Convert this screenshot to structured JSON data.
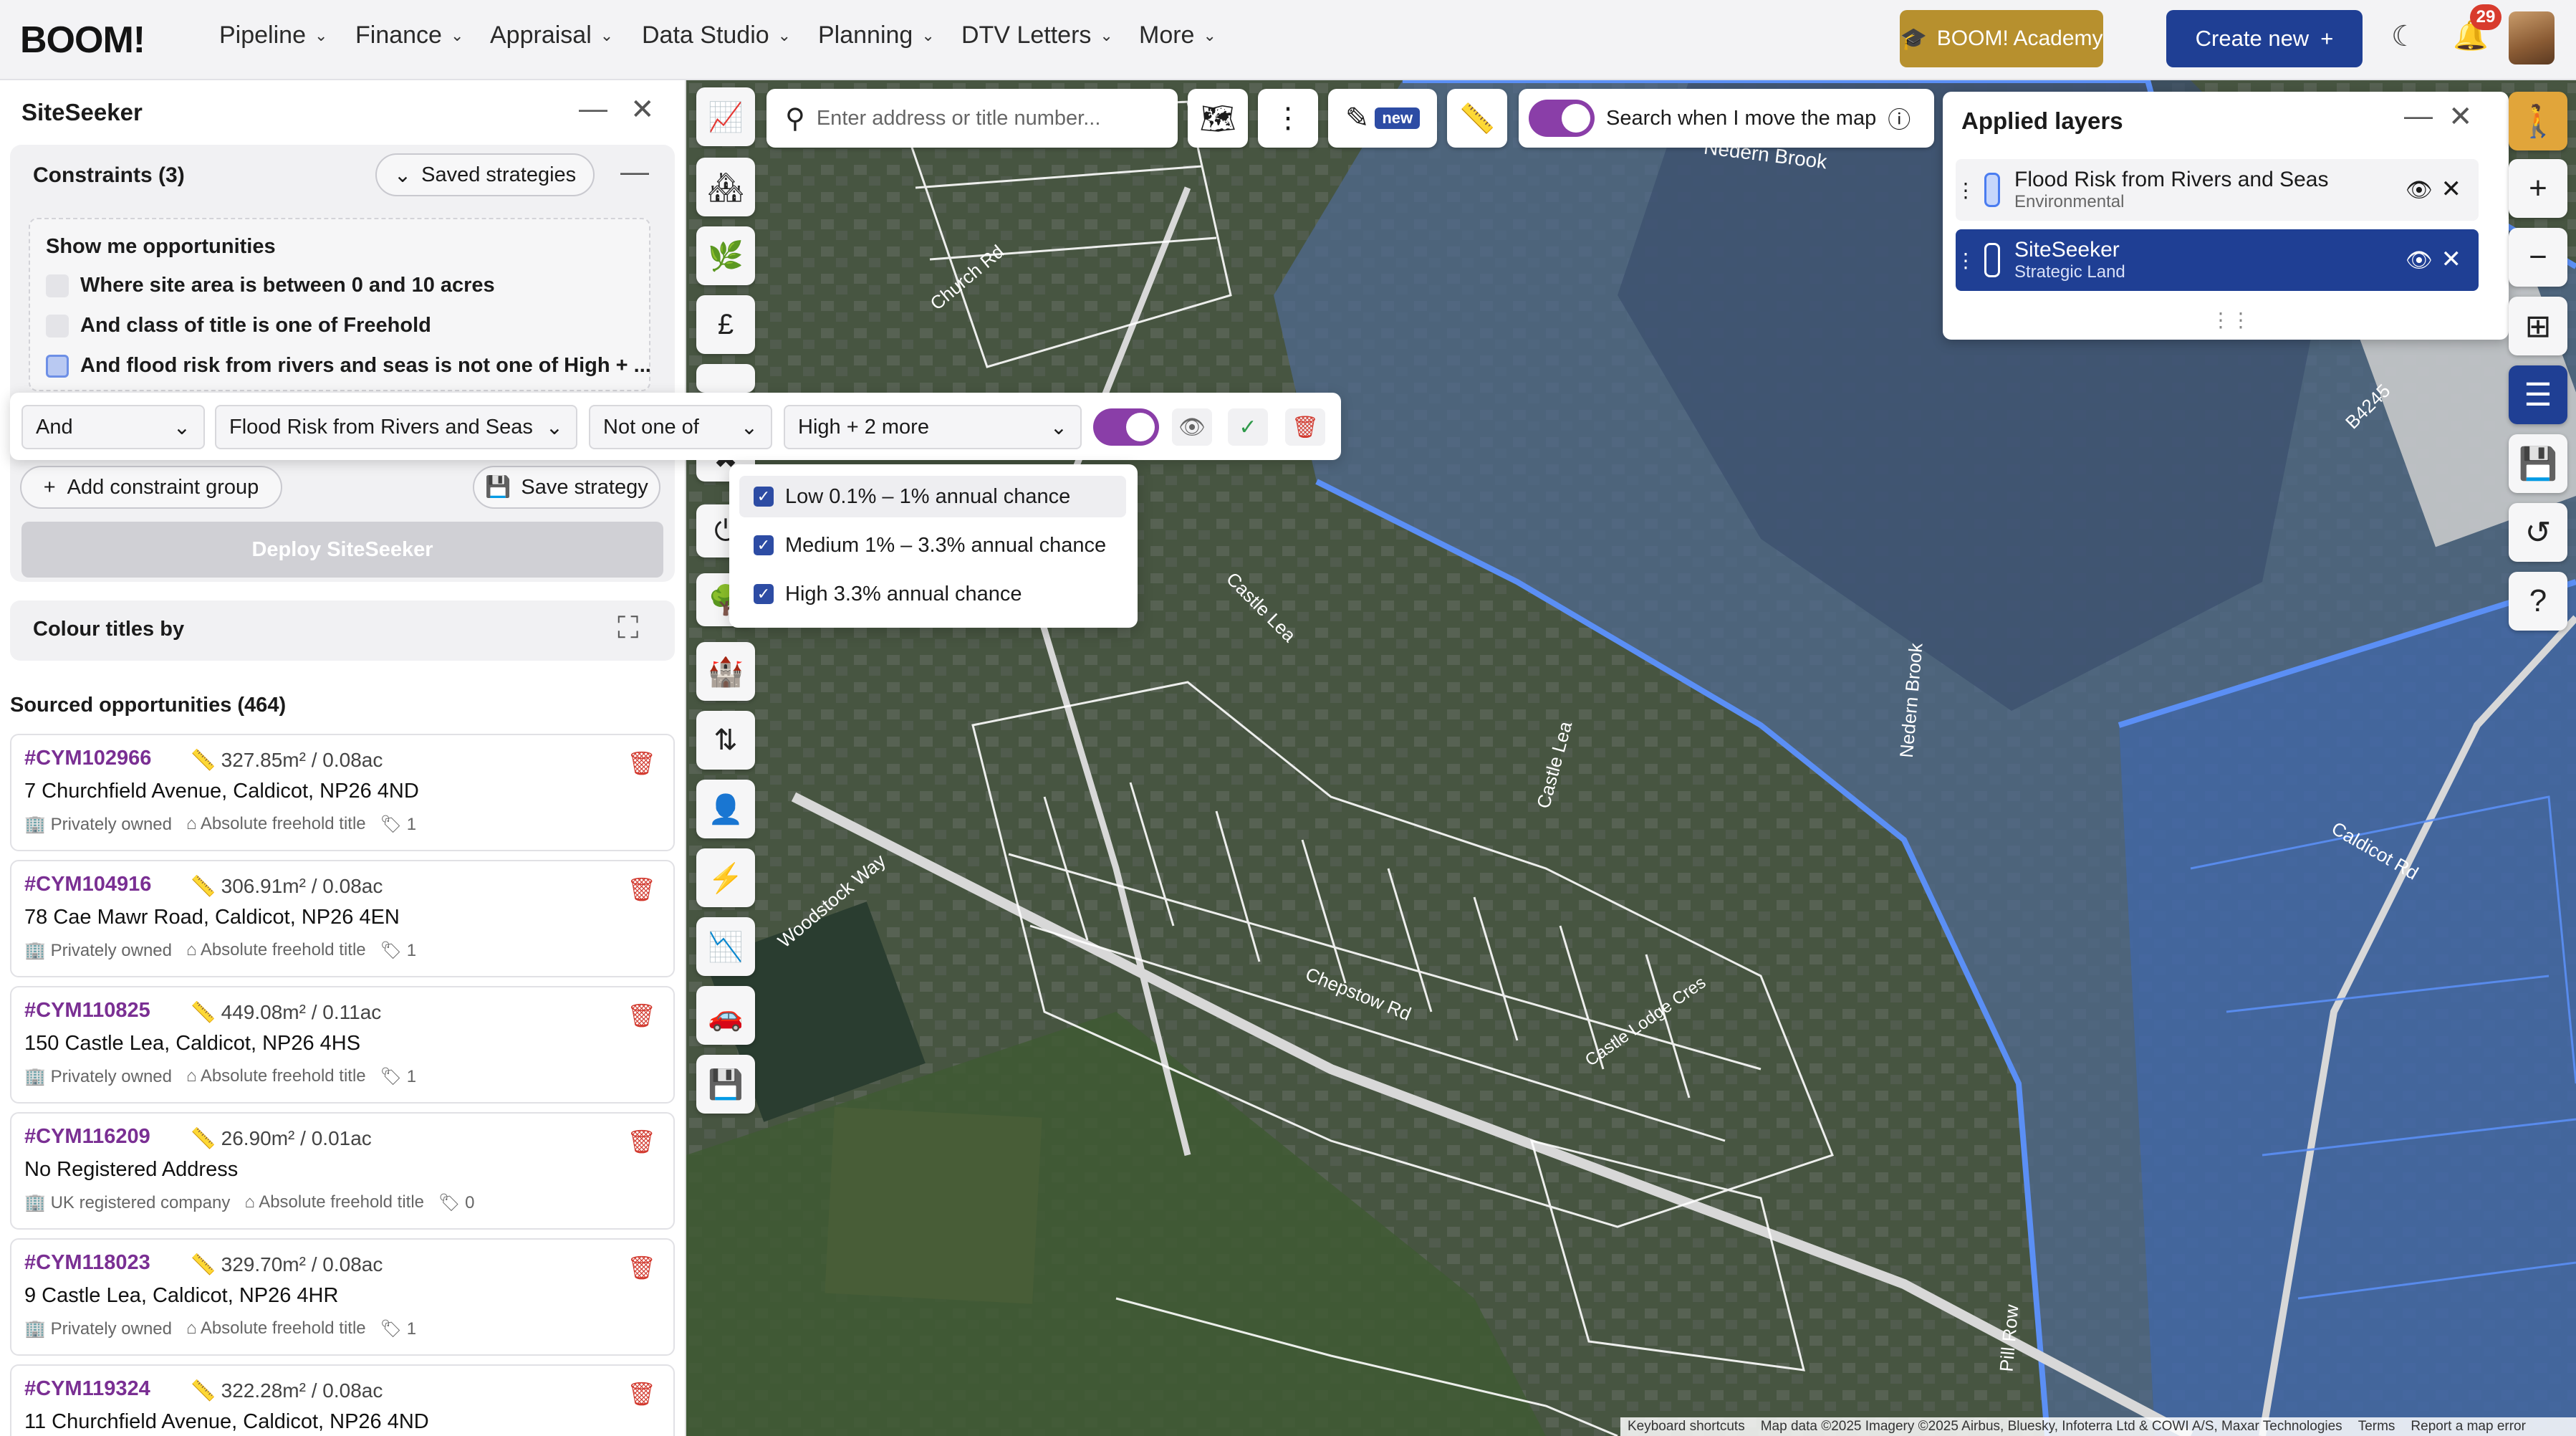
{
  "app": {
    "logo": "BOOM!"
  },
  "nav": {
    "items": [
      "Pipeline",
      "Finance",
      "Appraisal",
      "Data Studio",
      "Planning",
      "DTV Letters",
      "More"
    ],
    "academy": "BOOM! Academy",
    "create_new": "Create new",
    "notifications": "29"
  },
  "siteseeker": {
    "title": "SiteSeeker",
    "constraints_title": "Constraints (3)",
    "saved_strategies": "Saved strategies",
    "show_title": "Show me opportunities",
    "rows": [
      "Where site area is between 0 and 10 acres",
      "And class of title is one of Freehold",
      "And flood risk from rivers and seas is not one of High + ..."
    ],
    "editor": {
      "join": "And",
      "layer": "Flood Risk from Rivers and Seas",
      "operator": "Not one of",
      "value": "High + 2 more"
    },
    "options": [
      "Low 0.1% – 1% annual chance",
      "Medium 1% – 3.3% annual chance",
      "High 3.3% annual chance"
    ],
    "add_group": "Add constraint group",
    "save_strategy": "Save strategy",
    "deploy": "Deploy SiteSeeker",
    "colour_titles": "Colour titles by",
    "sourced": "Sourced opportunities (464)"
  },
  "opportunities": [
    {
      "ref": "#CYM102966",
      "area": "327.85m² / 0.08ac",
      "address": "7 Churchfield Avenue, Caldicot, NP26 4ND",
      "owner": "Privately owned",
      "title": "Absolute freehold title",
      "count": "1"
    },
    {
      "ref": "#CYM104916",
      "area": "306.91m² / 0.08ac",
      "address": "78 Cae Mawr Road, Caldicot, NP26 4EN",
      "owner": "Privately owned",
      "title": "Absolute freehold title",
      "count": "1"
    },
    {
      "ref": "#CYM110825",
      "area": "449.08m² / 0.11ac",
      "address": "150 Castle Lea, Caldicot, NP26 4HS",
      "owner": "Privately owned",
      "title": "Absolute freehold title",
      "count": "1"
    },
    {
      "ref": "#CYM116209",
      "area": "26.90m² / 0.01ac",
      "address": "No Registered Address",
      "owner": "UK registered company",
      "title": "Absolute freehold title",
      "count": "0"
    },
    {
      "ref": "#CYM118023",
      "area": "329.70m² / 0.08ac",
      "address": "9 Castle Lea, Caldicot, NP26 4HR",
      "owner": "Privately owned",
      "title": "Absolute freehold title",
      "count": "1"
    },
    {
      "ref": "#CYM119324",
      "area": "322.28m² / 0.08ac",
      "address": "11 Churchfield Avenue, Caldicot, NP26 4ND",
      "owner": "",
      "title": "",
      "count": ""
    }
  ],
  "map": {
    "search_placeholder": "Enter address or title number...",
    "new_tag": "new",
    "search_move": "Search when I move the map",
    "labels": [
      "Nedern Brook",
      "Church Rd",
      "Castle Lea",
      "Chepstow Rd",
      "Woodstock Way",
      "Castle Lodge Cres",
      "Caldicot Rd",
      "B4245",
      "Nedern Brook",
      "Pill Row",
      "Castle Lea"
    ],
    "attribution": [
      "Keyboard shortcuts",
      "Map data ©2025 Imagery ©2025 Airbus, Bluesky, Infoterra Ltd & COWI A/S, Maxar Technologies",
      "Terms",
      "Report a map error"
    ]
  },
  "layers": {
    "title": "Applied layers",
    "items": [
      {
        "name": "Flood Risk from Rivers and Seas",
        "sub": "Environmental"
      },
      {
        "name": "SiteSeeker",
        "sub": "Strategic Land"
      }
    ]
  },
  "colors": {
    "accent": "#1f3f94",
    "academy": "#b7902e",
    "purple": "#8a3ea8",
    "flood": "#4a7cf0",
    "ref": "#7a2f93"
  }
}
